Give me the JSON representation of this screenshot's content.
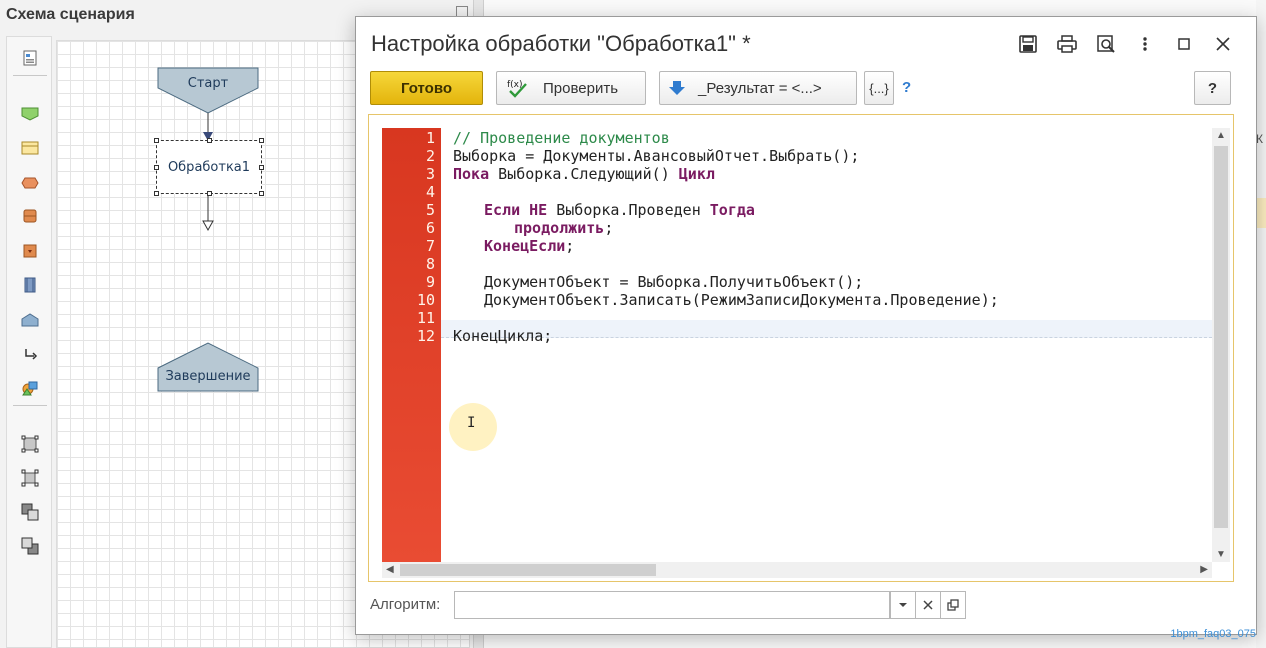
{
  "schema": {
    "title": "Схема сценария",
    "nodes": {
      "start": "Старт",
      "processing": "Обработка1",
      "finish": "Завершение"
    },
    "tools": [
      "schema-settings-icon",
      "action-shape-icon",
      "processing-shape-icon",
      "condition-shape-icon",
      "database-shape-icon",
      "nested-process-icon",
      "split-shape-icon",
      "start-shape-icon",
      "connector-icon",
      "decoration-icon",
      "group-icon",
      "ungroup-icon",
      "bring-front-icon",
      "send-back-icon"
    ]
  },
  "dialog": {
    "title": "Настройка обработки \"Обработка1\" *",
    "toolbar": {
      "ready_label": "Готово",
      "check_label": "Проверить",
      "result_label": "_Результат = <...>",
      "brace_label": "{...}",
      "help_qmark": "?",
      "help_button": "?"
    },
    "editor": {
      "line_numbers": [
        "1",
        "2",
        "3",
        "4",
        "5",
        "6",
        "7",
        "8",
        "9",
        "10",
        "11",
        "12"
      ],
      "lines": {
        "l1_comment": "// Проведение документов",
        "l2": "Выборка = Документы.АвансовыйОтчет.Выбрать();",
        "l3_kw_a": "Пока",
        "l3_mid": " Выборка.Следующий() ",
        "l3_kw_b": "Цикл",
        "l5_kw_a": "Если НЕ",
        "l5_mid": " Выборка.Проведен ",
        "l5_kw_b": "Тогда",
        "l6_kw": "продолжить",
        "l6_end": ";",
        "l7_kw": "КонецЕсли",
        "l7_end": ";",
        "l9": "ДокументОбъект = Выборка.ПолучитьОбъект();",
        "l10": "ДокументОбъект.Записать(РежимЗаписиДокумента.Проведение);",
        "l12": "КонецЦикла;"
      }
    },
    "algorithm": {
      "label": "Алгоритм:",
      "value": ""
    }
  },
  "background": {
    "tab_fragment": "К",
    "footer_tag": "1bpm_faq03_075"
  },
  "colors": {
    "ready_button": "#e9bd14",
    "gutter": "#dc3a22",
    "keyword": "#7a1b61",
    "comment": "#2d8a4a",
    "node_fill": "#b7c8d3"
  }
}
